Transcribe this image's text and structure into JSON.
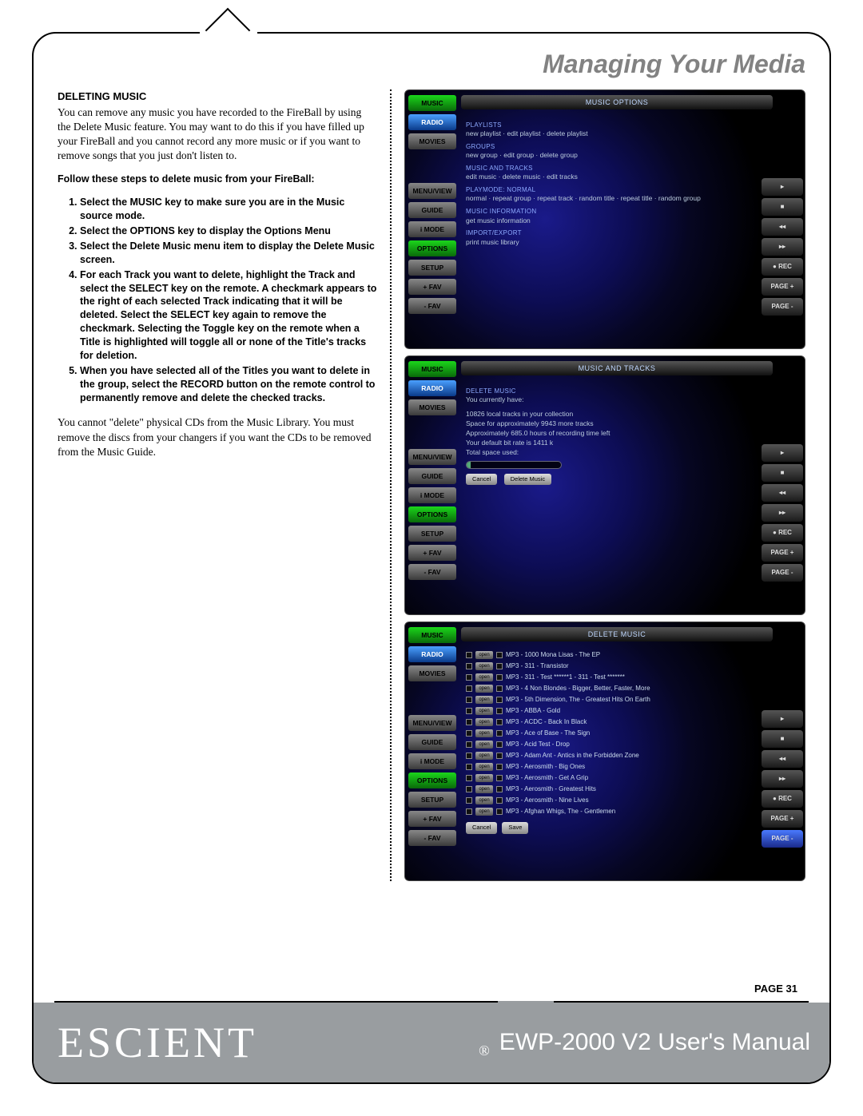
{
  "header": {
    "title": "Managing Your Media"
  },
  "section": {
    "heading": "DELETING MUSIC",
    "intro": "You can remove any music you have recorded to the FireBall by using the Delete Music feature. You may want to do this if you have filled up your FireBall and you cannot record any more music or if you want to remove songs that you just don't listen to.",
    "steps_lead": "Follow these steps to delete music from your FireBall:",
    "steps": [
      "Select the MUSIC key to make sure you are in the Music source mode.",
      "Select the OPTIONS key to display the Options Menu",
      "Select the Delete Music menu item to display the Delete Music screen.",
      "For each Track you want to delete, highlight the Track and select the SELECT key on the remote. A checkmark appears to the right of each selected Track indicating that it will be deleted. Select the SELECT key again to remove the checkmark. Selecting the Toggle key on the remote when a Title is highlighted will toggle all or none of the Title's tracks for deletion.",
      "When you have selected all of the Titles you want to delete in the group, select the RECORD button on the remote control to permanently remove and delete the checked tracks."
    ],
    "outro": "You cannot \"delete\" physical CDs from the Music Library. You must remove the discs from your changers if you want the CDs to be removed from the Music Guide."
  },
  "side_buttons": [
    "MUSIC",
    "RADIO",
    "MOVIES",
    "",
    "MENU/VIEW",
    "GUIDE",
    "i MODE",
    "OPTIONS",
    "SETUP",
    "+ FAV",
    "- FAV"
  ],
  "right_buttons": [
    "▸",
    "■",
    "◂◂",
    "▸▸",
    "● REC",
    "PAGE +",
    "PAGE -"
  ],
  "shot1": {
    "title": "MUSIC OPTIONS",
    "groups": [
      {
        "h": "PLAYLISTS",
        "t": "new playlist · edit playlist · delete playlist"
      },
      {
        "h": "GROUPS",
        "t": "new group · edit group · delete group"
      },
      {
        "h": "MUSIC AND TRACKS",
        "t": "edit music · delete music · edit tracks"
      },
      {
        "h": "PLAYMODE: NORMAL",
        "t": "normal · repeat group · repeat track · random title · repeat title · random group"
      },
      {
        "h": "MUSIC INFORMATION",
        "t": "get music information"
      },
      {
        "h": "IMPORT/EXPORT",
        "t": "print music library"
      }
    ]
  },
  "shot2": {
    "title": "MUSIC AND TRACKS",
    "sub": "DELETE MUSIC",
    "you_have": "You currently have:",
    "lines": [
      "10826 local tracks in your collection",
      "Space for approximately 9943 more tracks",
      "Approximately 685.0 hours of recording time left",
      "Your default bit rate is 1411 k",
      "Total space used:"
    ],
    "btns": [
      "Cancel",
      "Delete Music"
    ]
  },
  "shot3": {
    "title": "DELETE MUSIC",
    "rows": [
      "MP3 - 1000 Mona Lisas - The EP",
      "MP3 - 311 - Transistor",
      "MP3 - 311 - Test ******1 - 311 - Test *******",
      "MP3 - 4 Non Blondes - Bigger, Better, Faster, More",
      "MP3 - 5th Dimension, The - Greatest Hits On Earth",
      "MP3 - ABBA - Gold",
      "MP3 - ACDC - Back In Black",
      "MP3 - Ace of Base - The Sign",
      "MP3 - Acid Test - Drop",
      "MP3 - Adam Ant - Antics in the Forbidden Zone",
      "MP3 - Aerosmith - Big Ones",
      "MP3 - Aerosmith - Get A Grip",
      "MP3 - Aerosmith - Greatest Hits",
      "MP3 - Aerosmith - Nine Lives",
      "MP3 - Afghan Whigs, The - Gentlemen"
    ],
    "btns": [
      "Cancel",
      "Save"
    ]
  },
  "page": {
    "label": "PAGE 31"
  },
  "footer": {
    "brand": "ESCIENT",
    "reg": "®",
    "manual": "EWP-2000 V2 User's Manual"
  }
}
